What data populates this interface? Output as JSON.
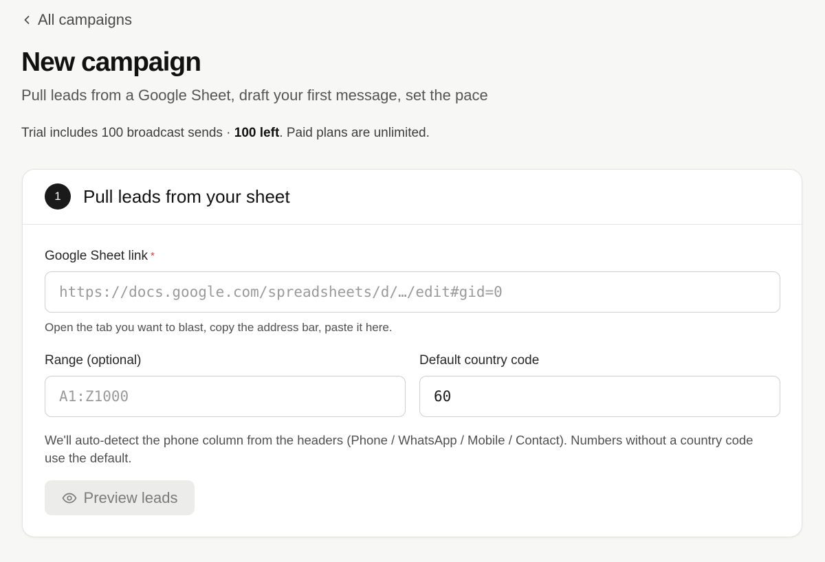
{
  "nav": {
    "back_label": "All campaigns"
  },
  "header": {
    "title": "New campaign",
    "subtitle": "Pull leads from a Google Sheet, draft your first message, set the pace"
  },
  "trial": {
    "text_before": "Trial includes 100 broadcast sends · ",
    "remaining": "100 left",
    "text_after": ". Paid plans are unlimited."
  },
  "step1": {
    "number": "1",
    "title": "Pull leads from your sheet",
    "sheet_link": {
      "label": "Google Sheet link",
      "required_mark": "*",
      "placeholder": "https://docs.google.com/spreadsheets/d/…/edit#gid=0",
      "value": "",
      "hint": "Open the tab you want to blast, copy the address bar, paste it here."
    },
    "range": {
      "label": "Range (optional)",
      "placeholder": "A1:Z1000",
      "value": ""
    },
    "country_code": {
      "label": "Default country code",
      "placeholder": "",
      "value": "60"
    },
    "detect_hint": "We'll auto-detect the phone column from the headers (Phone / WhatsApp / Mobile / Contact). Numbers without a country code use the default.",
    "preview_button": {
      "label": "Preview leads",
      "icon": "eye-icon"
    }
  },
  "colors": {
    "background": "#f7f7f5",
    "card": "#ffffff",
    "badge": "#1a1a1a",
    "required": "#d9363e",
    "button_bg": "#ececea",
    "button_text": "#7b7b7b"
  }
}
